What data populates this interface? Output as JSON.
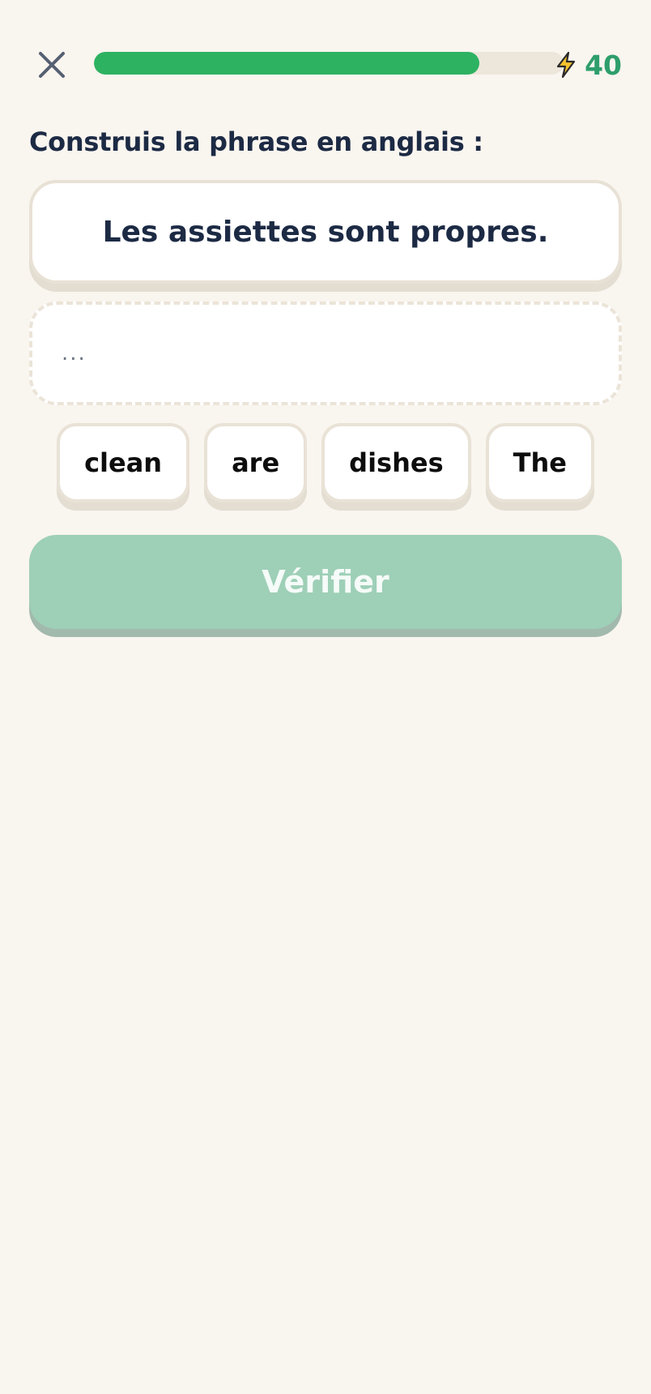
{
  "header": {
    "close_icon": "close-icon",
    "progress": 0.82,
    "progress_color": "#2db262",
    "streak_icon": "lightning-icon",
    "streak_count": "40"
  },
  "exercise": {
    "instruction": "Construis la phrase en anglais :",
    "prompt": "Les assiettes sont propres.",
    "answer_placeholder": "...",
    "word_bank": [
      "clean",
      "are",
      "dishes",
      "The"
    ]
  },
  "actions": {
    "check_label": "Vérifier",
    "check_color": "#9ecfb7"
  }
}
